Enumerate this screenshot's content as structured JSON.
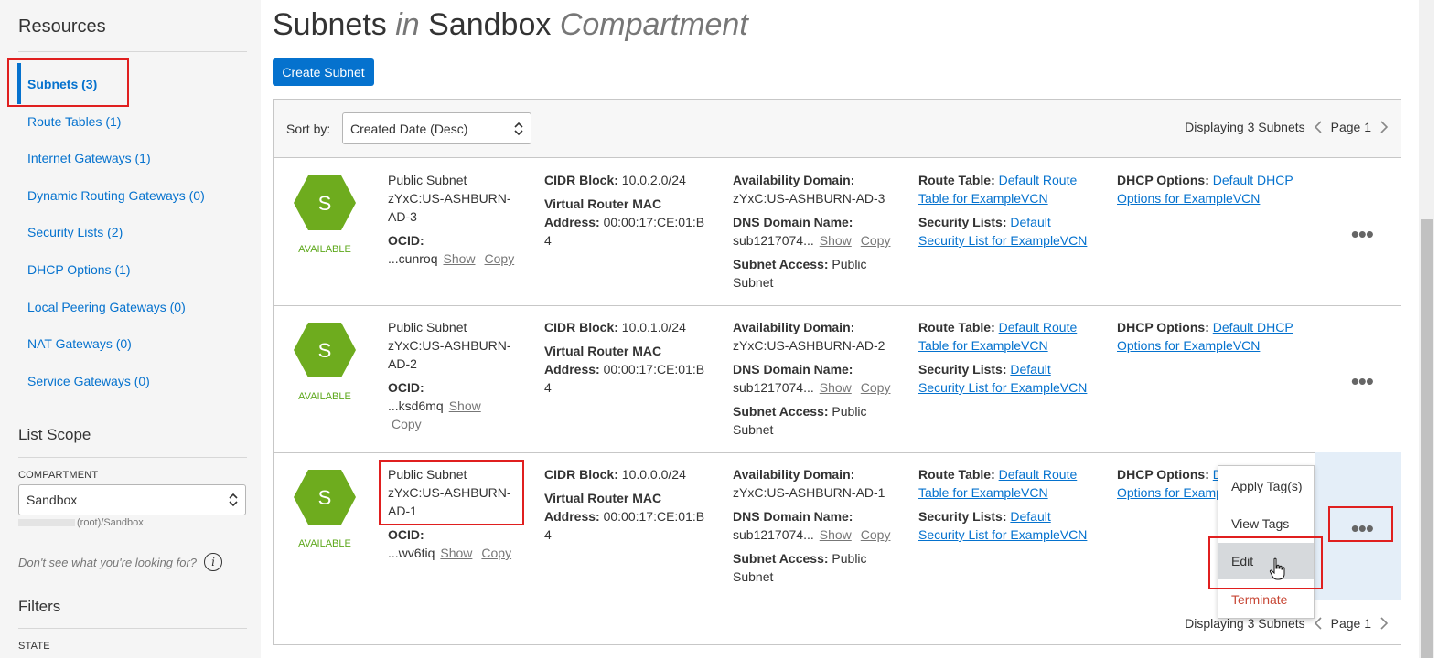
{
  "sidebar": {
    "resources_heading": "Resources",
    "resources": [
      {
        "label": "Subnets (3)",
        "active": true
      },
      {
        "label": "Route Tables (1)"
      },
      {
        "label": "Internet Gateways (1)"
      },
      {
        "label": "Dynamic Routing Gateways (0)"
      },
      {
        "label": "Security Lists (2)"
      },
      {
        "label": "DHCP Options (1)"
      },
      {
        "label": "Local Peering Gateways (0)"
      },
      {
        "label": "NAT Gateways (0)"
      },
      {
        "label": "Service Gateways (0)"
      }
    ],
    "list_scope_heading": "List Scope",
    "compartment_label": "COMPARTMENT",
    "compartment_value": "Sandbox",
    "compartment_path": "(root)/Sandbox",
    "dont_see_text": "Don't see what you're looking for?",
    "info_icon": "i",
    "filters_heading": "Filters",
    "state_label": "STATE"
  },
  "main": {
    "title_part1": "Subnets",
    "title_in": "in",
    "title_part2": "Sandbox",
    "title_part3": "Compartment",
    "create_button": "Create Subnet",
    "sort_label": "Sort by:",
    "sort_value": "Created Date (Desc)",
    "pager_text": "Displaying 3 Subnets",
    "page_text": "Page 1"
  },
  "subnets": [
    {
      "icon_letter": "S",
      "status": "AVAILABLE",
      "name_line1": "Public Subnet",
      "name_line2": "zYxC:US-ASHBURN-",
      "name_line3": "AD-3",
      "ocid_label": "OCID:",
      "ocid_value": "...cunroq",
      "show": "Show",
      "copy": "Copy",
      "cidr_label": "CIDR Block:",
      "cidr_value": "10.0.2.0/24",
      "mac_label1": "Virtual Router MAC",
      "mac_label2": "Address:",
      "mac_value1": "00:00:17:CE:01:B",
      "mac_value2": "4",
      "ad_label": "Availability Domain:",
      "ad_value": "zYxC:US-ASHBURN-AD-3",
      "dns_label": "DNS Domain Name:",
      "dns_value": "sub1217074...",
      "access_label": "Subnet Access:",
      "access_value1": "Public",
      "access_value2": "Subnet",
      "route_label": "Route Table:",
      "route_link1": "Default Route",
      "route_link2": "Table for ExampleVCN",
      "sec_label": "Security Lists:",
      "sec_link1": "Default",
      "sec_link2": "Security List for ExampleVCN",
      "dhcp_label": "DHCP Options:",
      "dhcp_link1": "Default DHCP",
      "dhcp_link2": "Options for ExampleVCN",
      "actions": "•••"
    },
    {
      "icon_letter": "S",
      "status": "AVAILABLE",
      "name_line1": "Public Subnet",
      "name_line2": "zYxC:US-ASHBURN-",
      "name_line3": "AD-2",
      "ocid_label": "OCID:",
      "ocid_value": "...ksd6mq",
      "show": "Show",
      "copy": "Copy",
      "cidr_label": "CIDR Block:",
      "cidr_value": "10.0.1.0/24",
      "mac_label1": "Virtual Router MAC",
      "mac_label2": "Address:",
      "mac_value1": "00:00:17:CE:01:B",
      "mac_value2": "4",
      "ad_label": "Availability Domain:",
      "ad_value": "zYxC:US-ASHBURN-AD-2",
      "dns_label": "DNS Domain Name:",
      "dns_value": "sub1217074...",
      "access_label": "Subnet Access:",
      "access_value1": "Public",
      "access_value2": "Subnet",
      "route_label": "Route Table:",
      "route_link1": "Default Route",
      "route_link2": "Table for ExampleVCN",
      "sec_label": "Security Lists:",
      "sec_link1": "Default",
      "sec_link2": "Security List for ExampleVCN",
      "dhcp_label": "DHCP Options:",
      "dhcp_link1": "Default DHCP",
      "dhcp_link2": "Options for ExampleVCN",
      "actions": "•••"
    },
    {
      "icon_letter": "S",
      "status": "AVAILABLE",
      "name_line1": "Public Subnet",
      "name_line2": "zYxC:US-ASHBURN-",
      "name_line3": "AD-1",
      "ocid_label": "OCID:",
      "ocid_value": "...wv6tiq",
      "show": "Show",
      "copy": "Copy",
      "cidr_label": "CIDR Block:",
      "cidr_value": "10.0.0.0/24",
      "mac_label1": "Virtual Router MAC",
      "mac_label2": "Address:",
      "mac_value1": "00:00:17:CE:01:B",
      "mac_value2": "4",
      "ad_label": "Availability Domain:",
      "ad_value": "zYxC:US-ASHBURN-AD-1",
      "dns_label": "DNS Domain Name:",
      "dns_value": "sub1217074...",
      "access_label": "Subnet Access:",
      "access_value1": "Public",
      "access_value2": "Subnet",
      "route_label": "Route Table:",
      "route_link1": "Default Route",
      "route_link2": "Table for ExampleVCN",
      "sec_label": "Security Lists:",
      "sec_link1": "Default",
      "sec_link2": "Security List for ExampleVCN",
      "dhcp_label": "DHCP Options:",
      "dhcp_link1": "De",
      "dhcp_link2": "Options for Examp",
      "actions": "•••"
    }
  ],
  "menu": {
    "items": [
      "Apply Tag(s)",
      "View Tags",
      "Edit",
      "Terminate"
    ],
    "hovered": "Edit"
  },
  "colors": {
    "accent": "#0572ce",
    "status_green": "#5ea81c",
    "hex_green": "#6eac1e",
    "danger": "#c74634",
    "highlight_box": "#e01f1f"
  }
}
